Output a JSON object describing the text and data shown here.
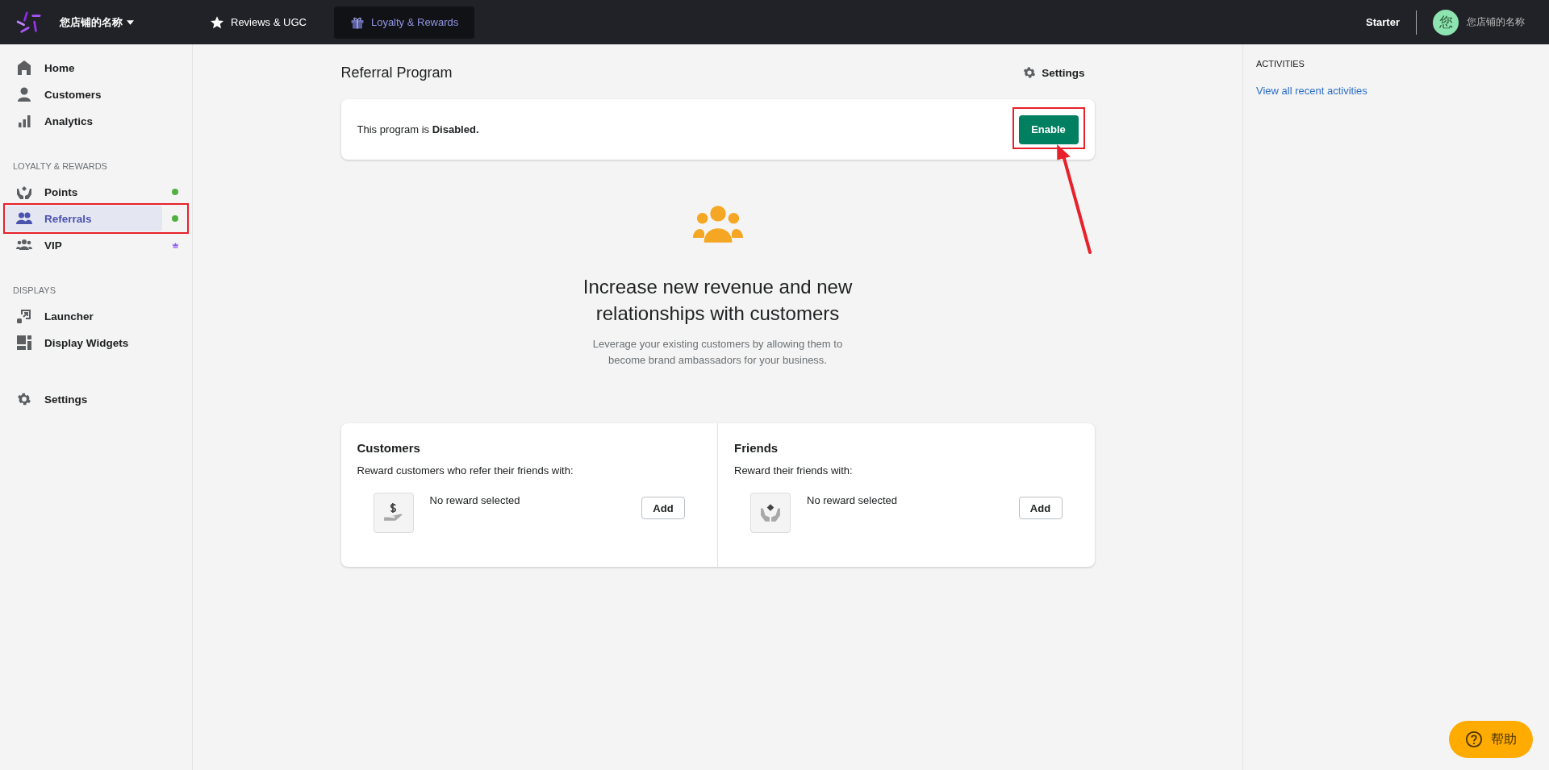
{
  "topbar": {
    "store_name": "您店铺的名称",
    "tabs": [
      {
        "label": "Reviews & UGC",
        "selected": false
      },
      {
        "label": "Loyalty & Rewards",
        "selected": true
      }
    ],
    "plan": "Starter",
    "avatar_initial": "您",
    "account_name": "您店铺的名称"
  },
  "sidebar": {
    "sections": [
      {
        "items": [
          {
            "label": "Home",
            "selected": false,
            "highlighted": false
          },
          {
            "label": "Customers",
            "selected": false,
            "highlighted": false
          },
          {
            "label": "Analytics",
            "selected": false,
            "highlighted": false
          }
        ]
      },
      {
        "title": "LOYALTY & REWARDS",
        "items": [
          {
            "label": "Points",
            "selected": false,
            "highlighted": false,
            "marker": {
              "kind": "dot",
              "color": "#52b043"
            }
          },
          {
            "label": "Referrals",
            "selected": true,
            "highlighted": true,
            "marker": {
              "kind": "dot",
              "color": "#52b043"
            }
          },
          {
            "label": "VIP",
            "selected": false,
            "highlighted": false,
            "marker": {
              "kind": "crown",
              "color": "#8b5cf6"
            }
          }
        ]
      },
      {
        "title": "DISPLAYS",
        "items": [
          {
            "label": "Launcher",
            "selected": false,
            "highlighted": false
          },
          {
            "label": "Display Widgets",
            "selected": false,
            "highlighted": false
          }
        ]
      },
      {
        "items": [
          {
            "label": "Settings",
            "selected": false,
            "highlighted": false
          }
        ]
      }
    ]
  },
  "page": {
    "title": "Referral Program",
    "settings_link": "Settings",
    "status_card": {
      "text": "This program is **Disabled.**",
      "button": "Enable",
      "highlighted": true,
      "arrow": true
    },
    "empty_state": {
      "heading": "Increase new revenue and new relationships with customers",
      "body": "Leverage your existing customers by allowing them to become brand ambassadors for your business."
    },
    "reward_panels": [
      {
        "title": "Customers",
        "description": "Reward customers who refer their friends with:",
        "status": "No reward selected",
        "button": "Add"
      },
      {
        "title": "Friends",
        "description": "Reward their friends with:",
        "status": "No reward selected",
        "button": "Add"
      }
    ]
  },
  "activities": {
    "title": "ACTIVITIES",
    "link": "View all recent activities"
  },
  "help_button": "帮助"
}
